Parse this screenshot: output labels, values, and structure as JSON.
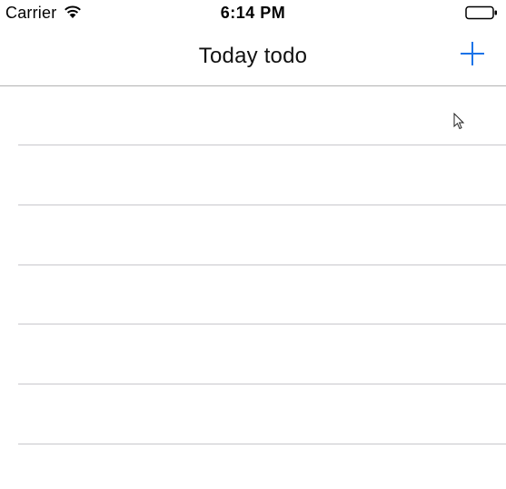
{
  "status_bar": {
    "carrier": "Carrier",
    "time": "6:14 PM",
    "wifi_icon": "wifi-icon",
    "battery_icon": "battery-icon"
  },
  "nav_bar": {
    "title": "Today todo",
    "add_icon": "plus-icon",
    "accent_color": "#1a73e8"
  },
  "table": {
    "row_count": 6,
    "separator_color": "#c8c7cc"
  },
  "cursor_icon": "mouse-pointer-icon"
}
